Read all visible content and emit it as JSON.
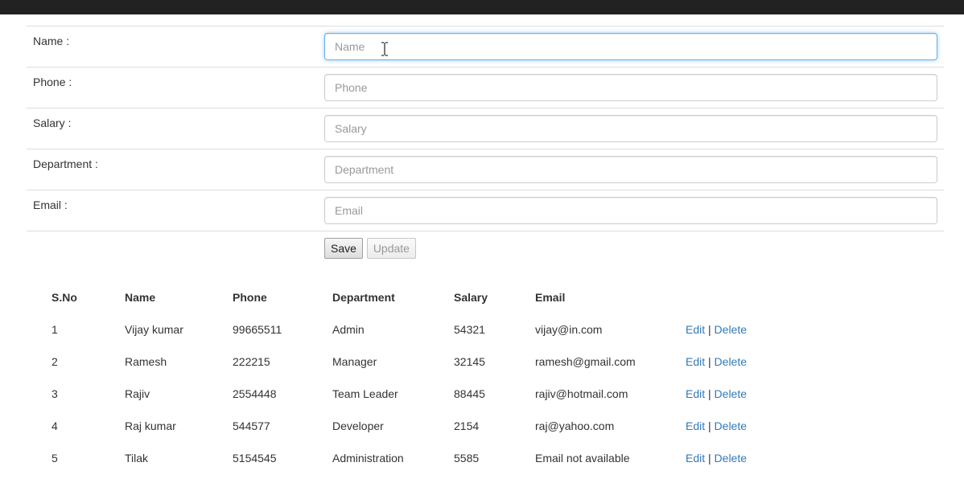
{
  "form": {
    "fields": [
      {
        "label": "Name :",
        "placeholder": "Name",
        "value": ""
      },
      {
        "label": "Phone :",
        "placeholder": "Phone",
        "value": ""
      },
      {
        "label": "Salary :",
        "placeholder": "Salary",
        "value": ""
      },
      {
        "label": "Department :",
        "placeholder": "Department",
        "value": ""
      },
      {
        "label": "Email :",
        "placeholder": "Email",
        "value": ""
      }
    ],
    "focused_field": "Name",
    "save_label": "Save",
    "update_label": "Update"
  },
  "table": {
    "headers": [
      "S.No",
      "Name",
      "Phone",
      "Department",
      "Salary",
      "Email"
    ],
    "rows": [
      {
        "sno": "1",
        "name": "Vijay kumar",
        "phone": "99665511",
        "department": "Admin",
        "salary": "54321",
        "email": "vijay@in.com"
      },
      {
        "sno": "2",
        "name": "Ramesh",
        "phone": "222215",
        "department": "Manager",
        "salary": "32145",
        "email": "ramesh@gmail.com"
      },
      {
        "sno": "3",
        "name": "Rajiv",
        "phone": "2554448",
        "department": "Team Leader",
        "salary": "88445",
        "email": "rajiv@hotmail.com"
      },
      {
        "sno": "4",
        "name": "Raj kumar",
        "phone": "544577",
        "department": "Developer",
        "salary": "2154",
        "email": "raj@yahoo.com"
      },
      {
        "sno": "5",
        "name": "Tilak",
        "phone": "5154545",
        "department": "Administration",
        "salary": "5585",
        "email": "Email not available"
      }
    ],
    "edit_label": "Edit",
    "delete_label": "Delete",
    "separator": "|"
  },
  "colors": {
    "topbar": "#222222",
    "link": "#337ab7",
    "focus_border": "#66afe9"
  }
}
